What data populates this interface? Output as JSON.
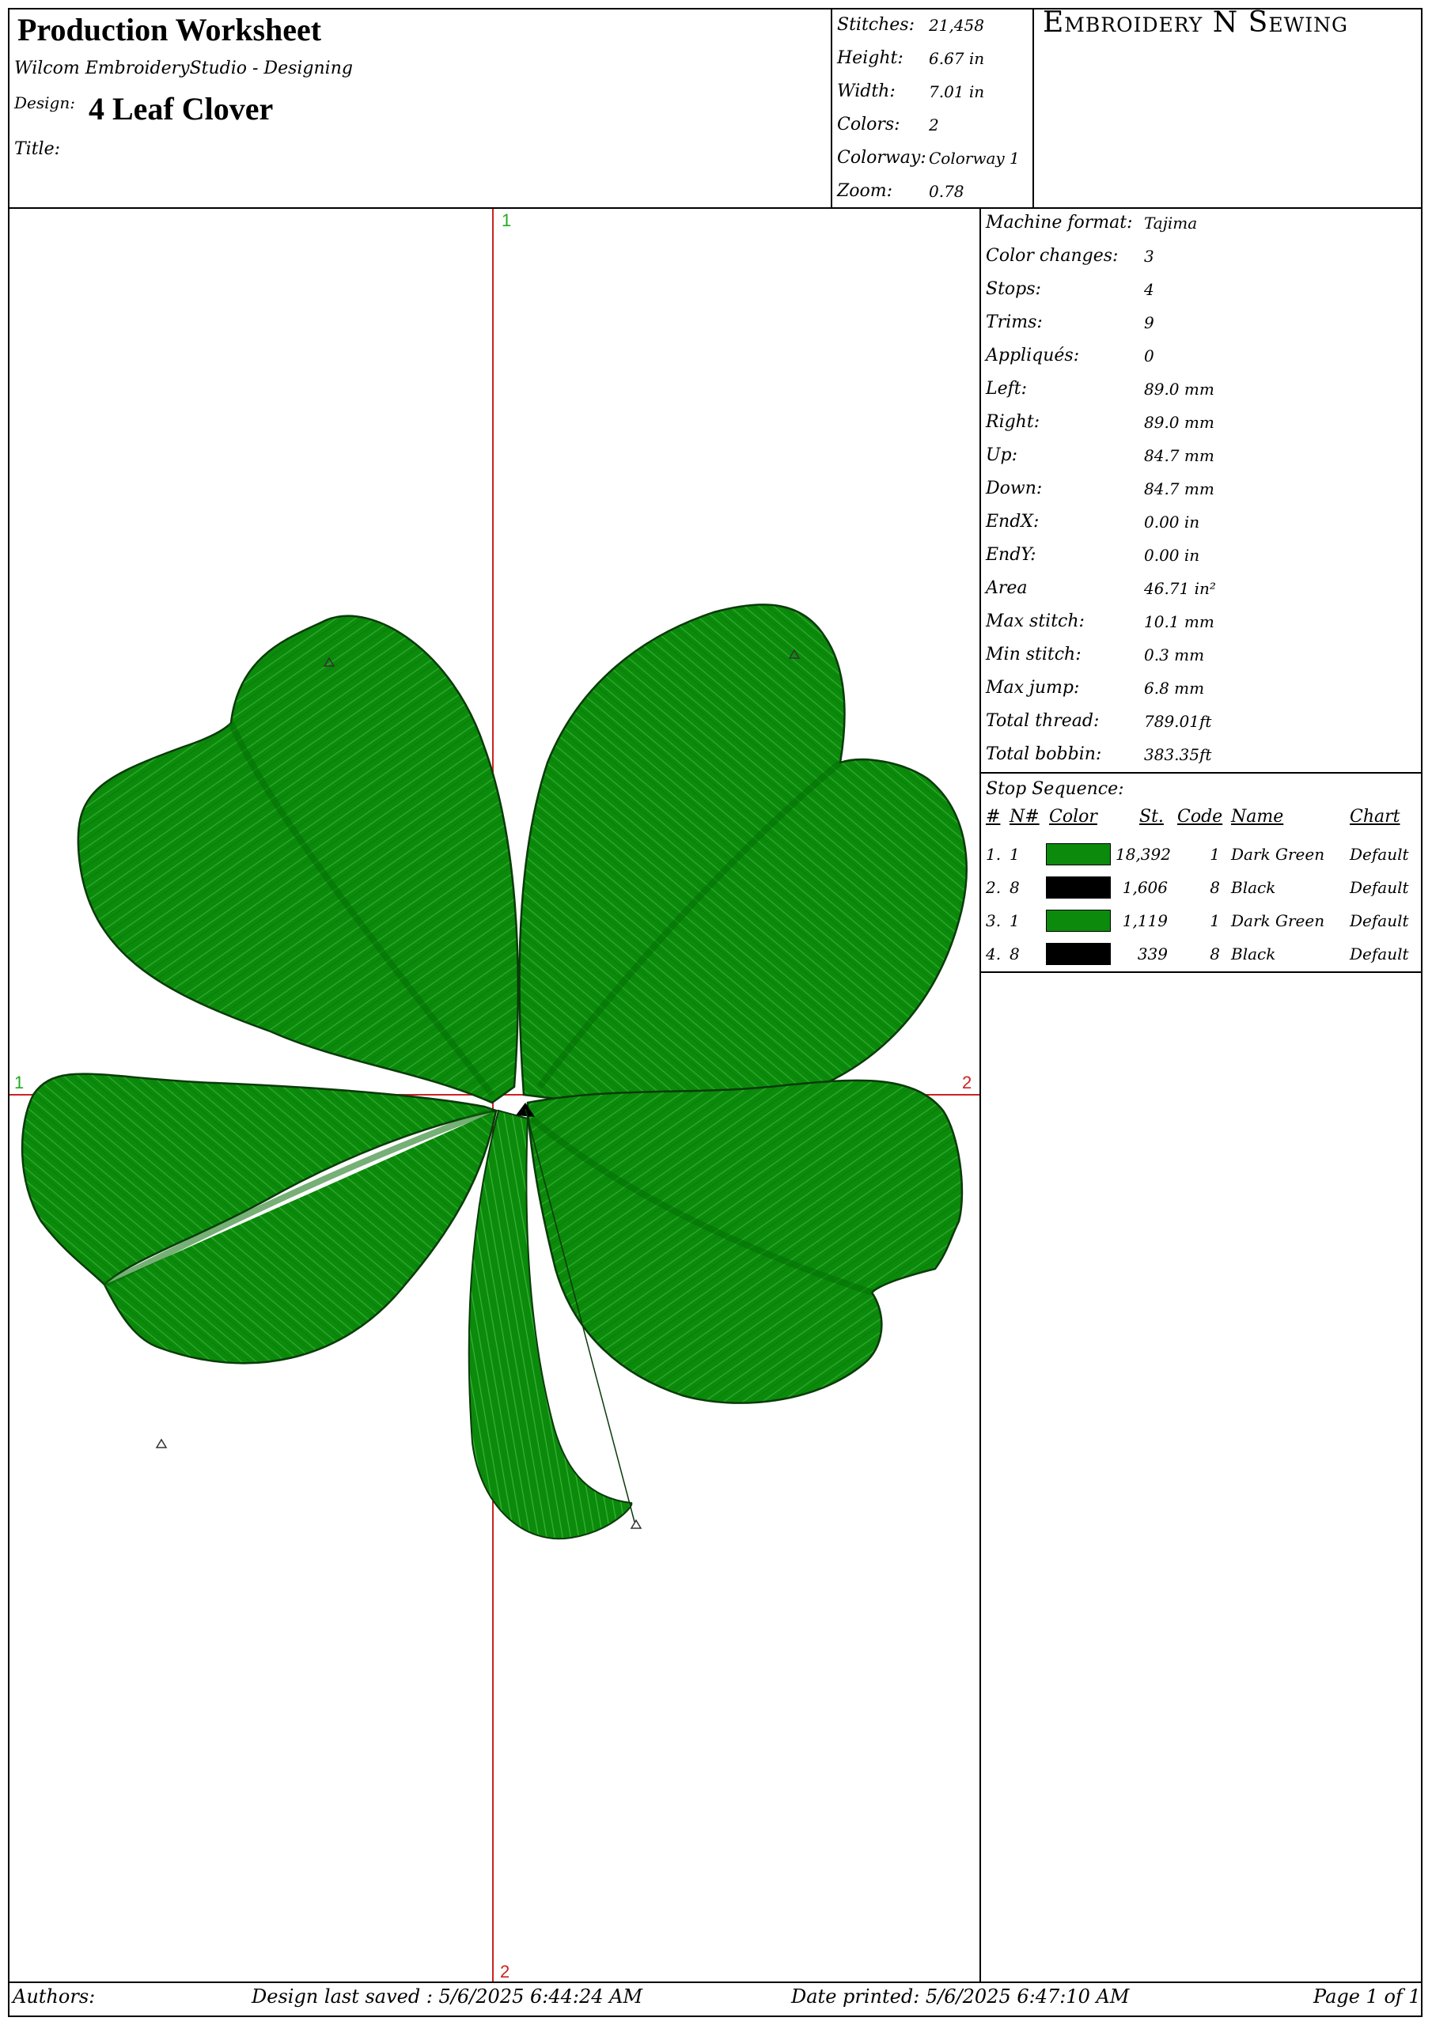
{
  "header": {
    "title": "Production Worksheet",
    "software": "Wilcom EmbroideryStudio - Designing",
    "design_label": "Design:",
    "design_name": "4 Leaf Clover",
    "title_label": "Title:",
    "brand": "Embroidery N Sewing"
  },
  "summary": [
    {
      "label": "Stitches:",
      "value": "21,458"
    },
    {
      "label": "Height:",
      "value": "6.67  in"
    },
    {
      "label": "Width:",
      "value": "7.01  in"
    },
    {
      "label": "Colors:",
      "value": "2"
    },
    {
      "label": "Colorway:",
      "value": "Colorway 1"
    },
    {
      "label": "Zoom:",
      "value": "0.78"
    }
  ],
  "stats": [
    {
      "label": "Machine format:",
      "value": "Tajima"
    },
    {
      "label": "Color changes:",
      "value": "3"
    },
    {
      "label": "Stops:",
      "value": "4"
    },
    {
      "label": "Trims:",
      "value": "9"
    },
    {
      "label": "Appliqués:",
      "value": "0"
    },
    {
      "label": "Left:",
      "value": "89.0  mm"
    },
    {
      "label": "Right:",
      "value": "89.0  mm"
    },
    {
      "label": "Up:",
      "value": "84.7  mm"
    },
    {
      "label": "Down:",
      "value": "84.7  mm"
    },
    {
      "label": "EndX:",
      "value": "0.00  in"
    },
    {
      "label": "EndY:",
      "value": "0.00  in"
    },
    {
      "label": "Area",
      "value": "46.71  in²"
    },
    {
      "label": "Max stitch:",
      "value": "10.1  mm"
    },
    {
      "label": "Min stitch:",
      "value": "0.3  mm"
    },
    {
      "label": "Max jump:",
      "value": "6.8  mm"
    },
    {
      "label": "Total thread:",
      "value": "789.01ft"
    },
    {
      "label": "Total bobbin:",
      "value": "383.35ft"
    }
  ],
  "stop_sequence": {
    "title": "Stop Sequence:",
    "headers": {
      "num": "#",
      "needle": "N#",
      "color": "Color",
      "stitches": "St.",
      "code": "Code",
      "name": "Name",
      "chart": "Chart"
    },
    "rows": [
      {
        "num": "1.",
        "needle": "1",
        "swatch": "#0b8a0b",
        "stitches": "18,392",
        "code": "1",
        "name": "Dark Green",
        "chart": "Default"
      },
      {
        "num": "2.",
        "needle": "8",
        "swatch": "#000000",
        "stitches": "1,606",
        "code": "8",
        "name": "Black",
        "chart": "Default"
      },
      {
        "num": "3.",
        "needle": "1",
        "swatch": "#0b8a0b",
        "stitches": "1,119",
        "code": "1",
        "name": "Dark Green",
        "chart": "Default"
      },
      {
        "num": "4.",
        "needle": "8",
        "swatch": "#000000",
        "stitches": "339",
        "code": "8",
        "name": "Black",
        "chart": "Default"
      }
    ]
  },
  "canvas": {
    "axis_v_top": "1",
    "axis_v_bottom": "2",
    "axis_h_left": "1",
    "axis_h_right": "2",
    "axis_color": "#cc2222",
    "axis_label_green": "#22aa22",
    "axis_label_red": "#cc2222",
    "leaf_color": "#0b8a0b",
    "outline_color": "#0a3a0a"
  },
  "footer": {
    "authors": "Authors:",
    "saved": "Design last saved : 5/6/2025 6:44:24 AM",
    "printed": "Date printed: 5/6/2025 6:47:10 AM",
    "page": "Page 1 of 1"
  }
}
